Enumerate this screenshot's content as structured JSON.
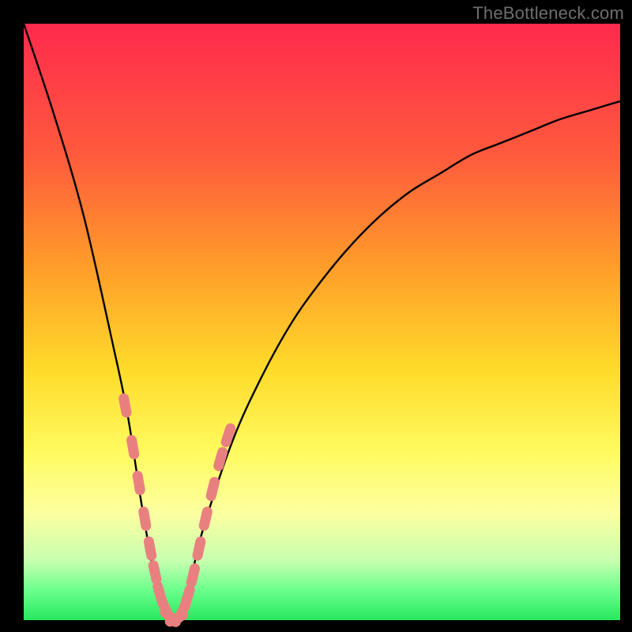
{
  "watermark": "TheBottleneck.com",
  "colors": {
    "frame": "#000000",
    "curve": "#000000",
    "marker_fill": "#e98080",
    "marker_stroke": "#c46a6a"
  },
  "chart_data": {
    "type": "line",
    "title": "",
    "xlabel": "",
    "ylabel": "",
    "xlim": [
      0,
      100
    ],
    "ylim": [
      0,
      100
    ],
    "note": "No axis labels or tick labels are rendered in the image. Values are the approximate vertical position (bottleneck %) of the drawn curve at evenly spaced horizontal positions, read against the color gradient (top=100, bottom=0).",
    "series": [
      {
        "name": "bottleneck-curve",
        "x": [
          0,
          5,
          10,
          15,
          17.5,
          20,
          22.5,
          25,
          27.5,
          30,
          35,
          40,
          45,
          50,
          55,
          60,
          65,
          70,
          75,
          80,
          85,
          90,
          95,
          100
        ],
        "y": [
          100,
          85,
          68,
          46,
          34,
          18,
          5,
          0,
          5,
          15,
          30,
          41,
          50,
          57,
          63,
          68,
          72,
          75,
          78,
          80,
          82,
          84,
          85.5,
          87
        ]
      }
    ],
    "markers": {
      "name": "highlighted-points",
      "note": "Pink rounded segments clustered along both sides of the V near the bottom.",
      "points": [
        {
          "x": 17.0,
          "y": 36
        },
        {
          "x": 18.3,
          "y": 29
        },
        {
          "x": 19.3,
          "y": 23
        },
        {
          "x": 20.3,
          "y": 17
        },
        {
          "x": 21.2,
          "y": 12
        },
        {
          "x": 22.0,
          "y": 8
        },
        {
          "x": 22.8,
          "y": 4.5
        },
        {
          "x": 23.7,
          "y": 2
        },
        {
          "x": 24.6,
          "y": 0.5
        },
        {
          "x": 25.6,
          "y": 0.3
        },
        {
          "x": 26.6,
          "y": 1.5
        },
        {
          "x": 27.5,
          "y": 4
        },
        {
          "x": 28.4,
          "y": 7.5
        },
        {
          "x": 29.4,
          "y": 12
        },
        {
          "x": 30.5,
          "y": 17
        },
        {
          "x": 31.7,
          "y": 22
        },
        {
          "x": 33.0,
          "y": 27
        },
        {
          "x": 34.3,
          "y": 31
        }
      ]
    }
  }
}
